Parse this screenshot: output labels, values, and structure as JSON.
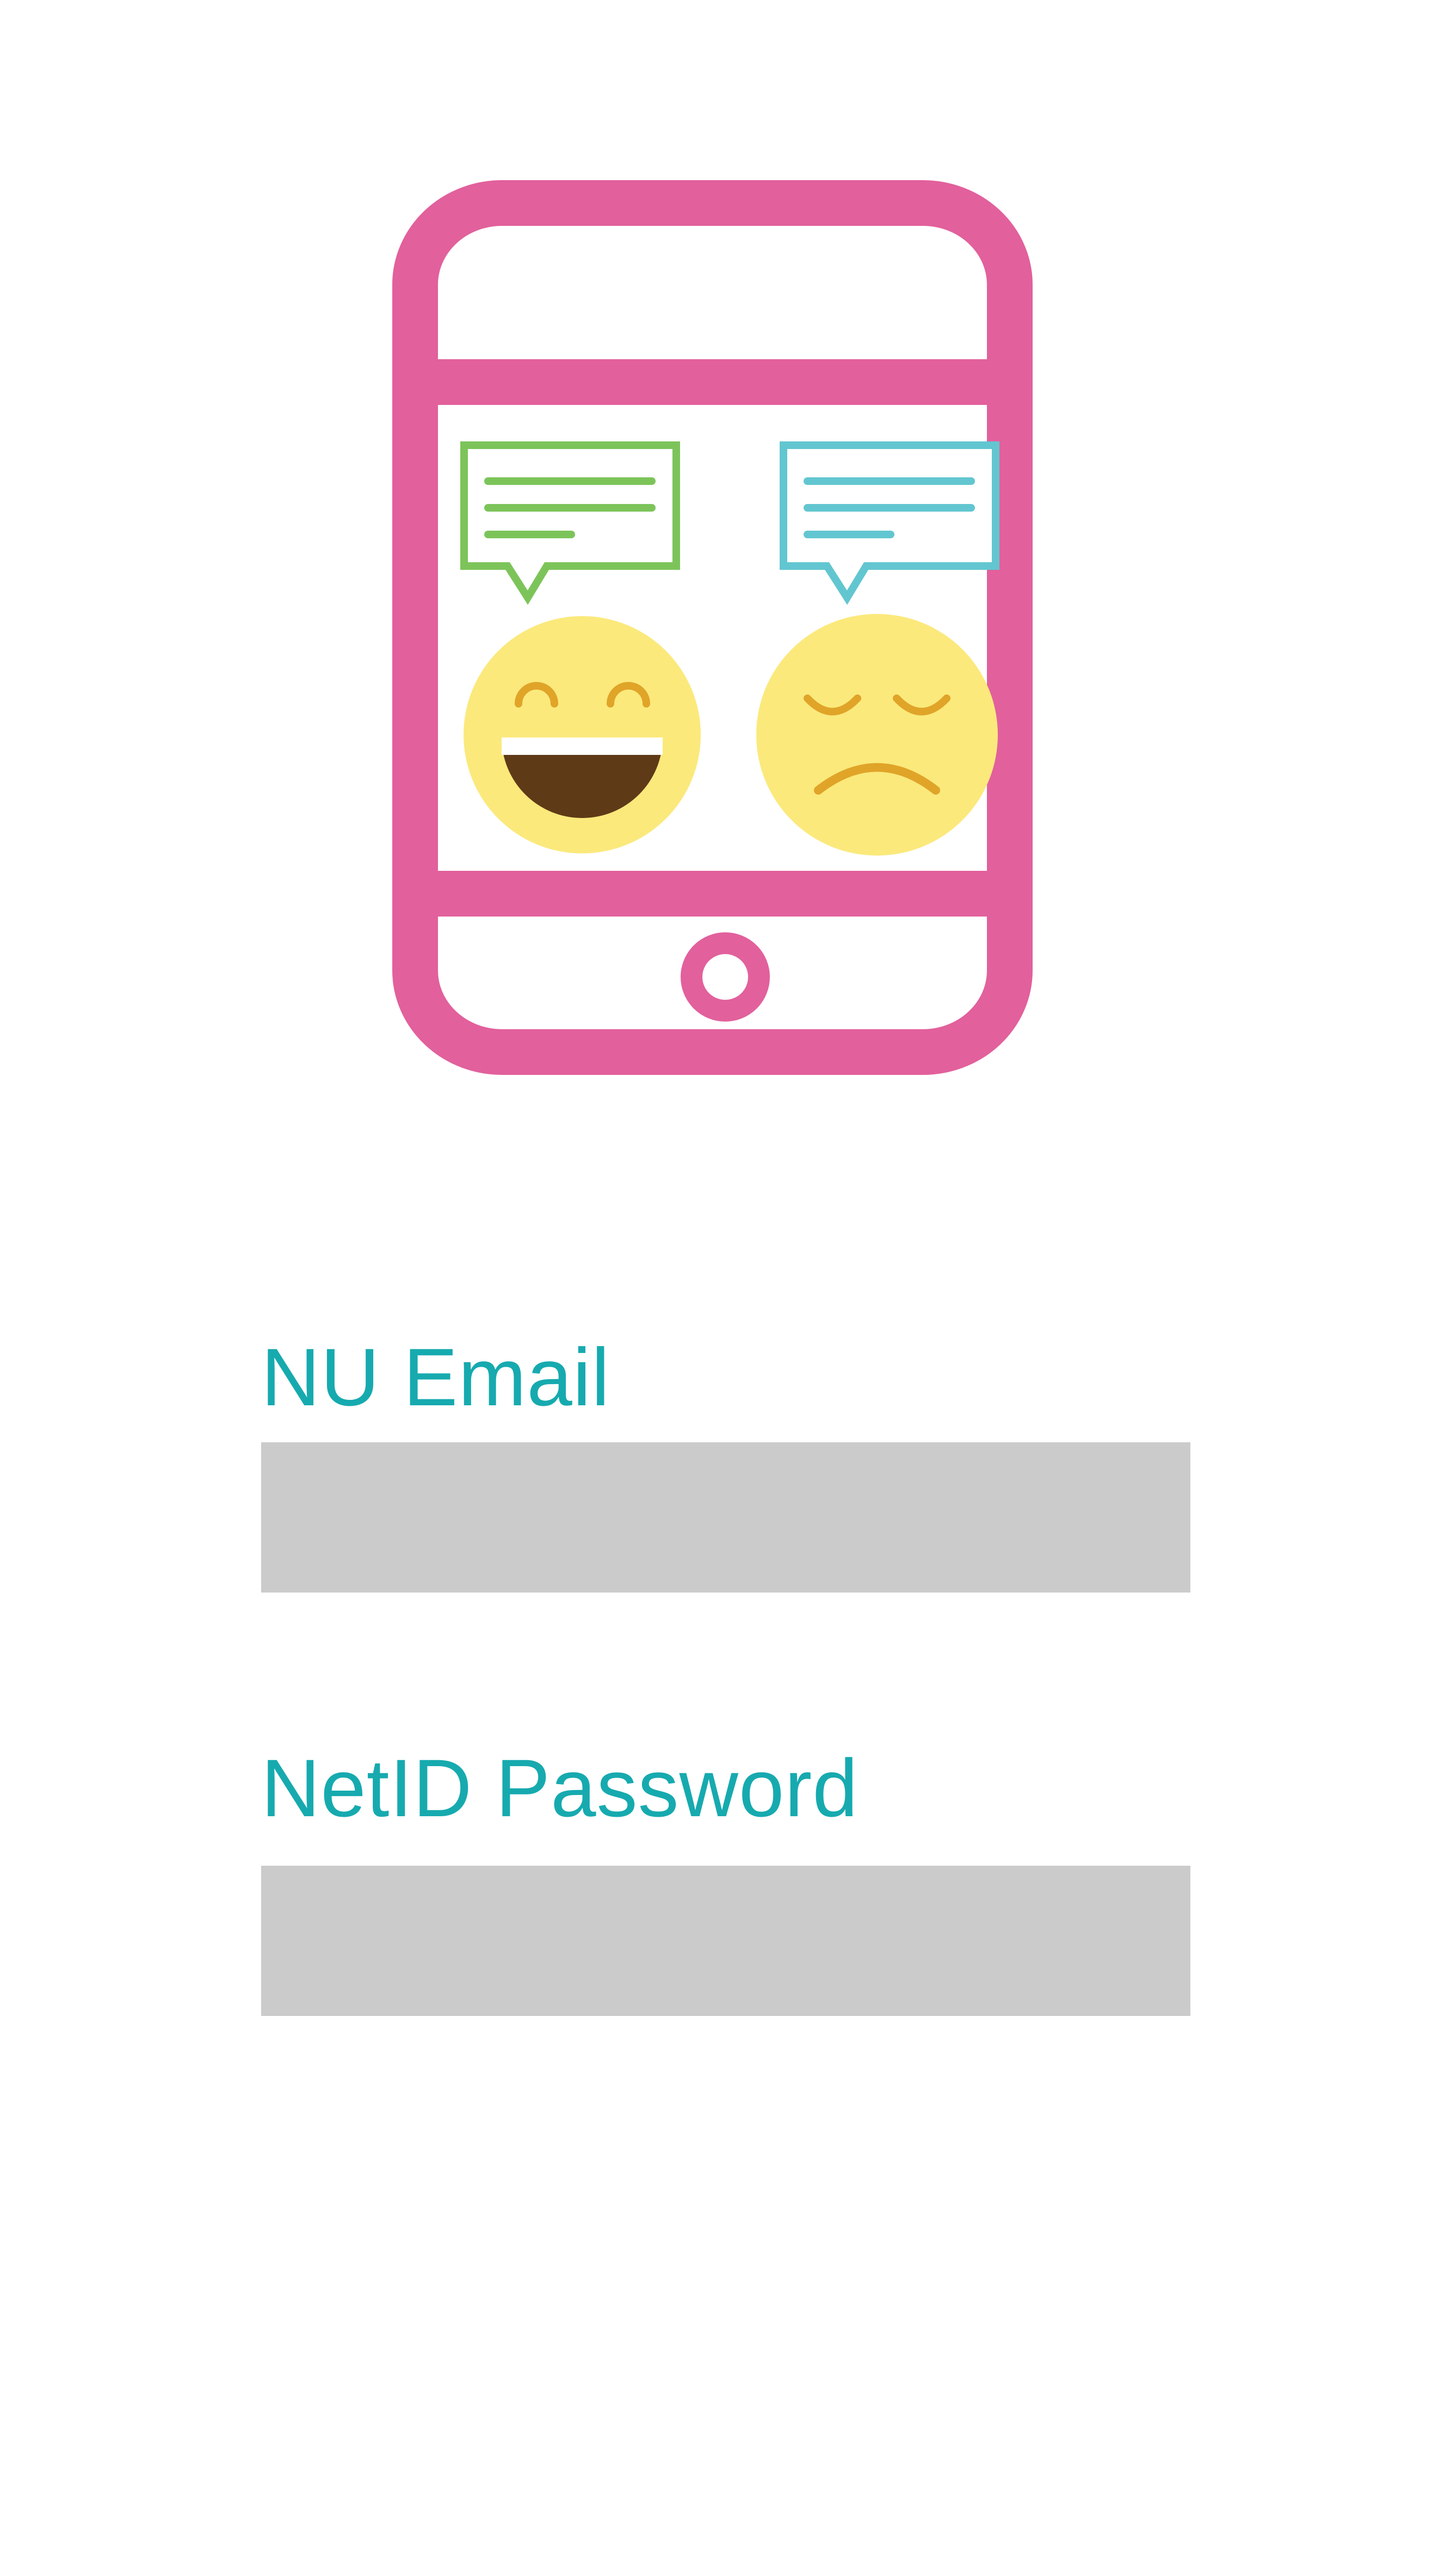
{
  "colors": {
    "accent": "#16aaaf",
    "phone": "#e2609c",
    "input_background": "#cbcbcb",
    "bubble_left": "#7cc45a",
    "bubble_right": "#62c6d0",
    "face": "#fbe97c",
    "face_features": "#e0a428",
    "mouth": "#5f3a17"
  },
  "logo": {
    "icons": [
      "smartphone-icon",
      "speech-bubble-icon",
      "happy-face-icon",
      "sad-face-icon"
    ]
  },
  "form": {
    "email": {
      "label": "NU Email",
      "value": "",
      "placeholder": ""
    },
    "password": {
      "label": "NetID Password",
      "value": "",
      "placeholder": ""
    }
  }
}
